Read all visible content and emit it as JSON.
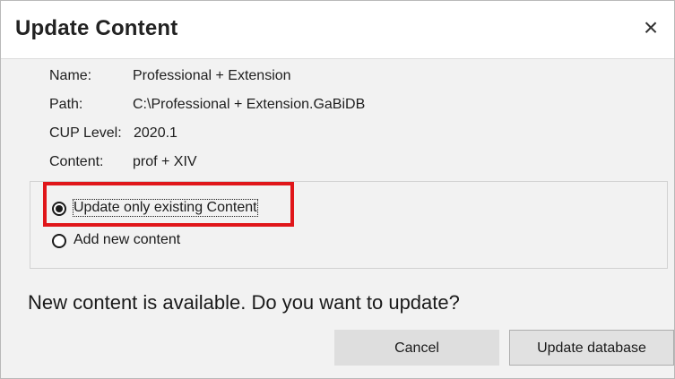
{
  "window": {
    "title": "Update Content",
    "close_label": "×"
  },
  "info": {
    "name_label": "Name:",
    "name_value": "Professional + Extension",
    "path_label": "Path:",
    "path_value": "C:\\Professional + Extension.GaBiDB",
    "cup_label": "CUP Level:",
    "cup_value": "2020.1",
    "content_label": "Content:",
    "content_value": "prof + XIV"
  },
  "options": {
    "selected": "Update only existing Content",
    "items": [
      {
        "label": "Update only existing Content",
        "checked": true
      },
      {
        "label": "Add new content",
        "checked": false
      }
    ]
  },
  "question": "New content is available. Do you want to update?",
  "buttons": {
    "cancel_label": "Cancel",
    "update_label": "Update database"
  },
  "colors": {
    "highlight": "#e0161a",
    "body_background": "#f2f2f2"
  }
}
